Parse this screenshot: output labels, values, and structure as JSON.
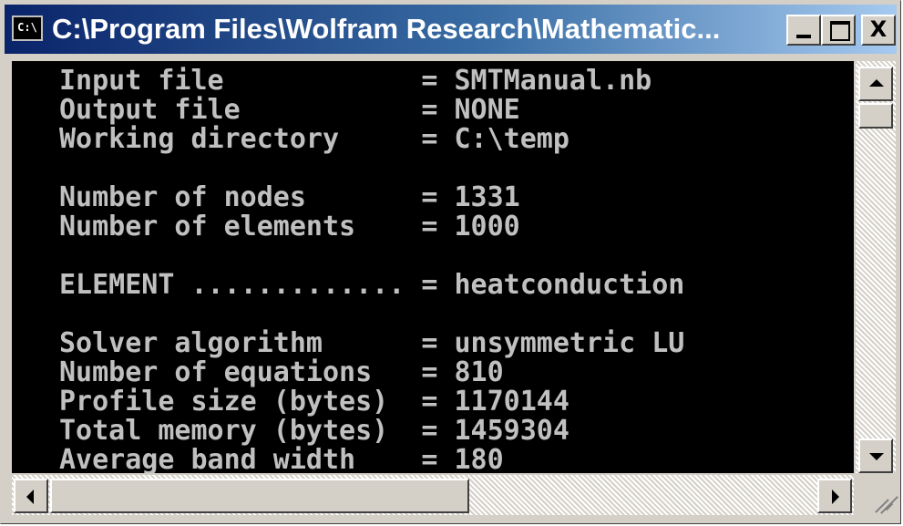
{
  "window": {
    "title": "C:\\Program Files\\Wolfram Research\\Mathematic...",
    "icon_label": "C:\\"
  },
  "console_lines": [
    "Input file            = SMTManual.nb",
    "Output file           = NONE",
    "Working directory     = C:\\temp",
    "",
    "Number of nodes       = 1331",
    "Number of elements    = 1000",
    "",
    "ELEMENT ............. = heatconduction",
    "",
    "Solver algorithm      = unsymmetric LU",
    "Number of equations   = 810",
    "Profile size (bytes)  = 1170144",
    "Total memory (bytes)  = 1459304",
    "Average band width    = 180"
  ],
  "icons": {
    "system": "console-icon",
    "minimize": "minimize-icon",
    "maximize": "maximize-icon",
    "close": "close-icon",
    "scroll_up": "arrow-up-icon",
    "scroll_down": "arrow-down-icon",
    "scroll_left": "arrow-left-icon",
    "scroll_right": "arrow-right-icon",
    "resize": "resize-grip-icon"
  },
  "colors": {
    "title_start": "#0a246a",
    "title_end": "#a6caf0",
    "console_bg": "#000000",
    "console_text": "#c0c0c0",
    "chrome": "#d4d0c8"
  },
  "close_glyph": "X"
}
